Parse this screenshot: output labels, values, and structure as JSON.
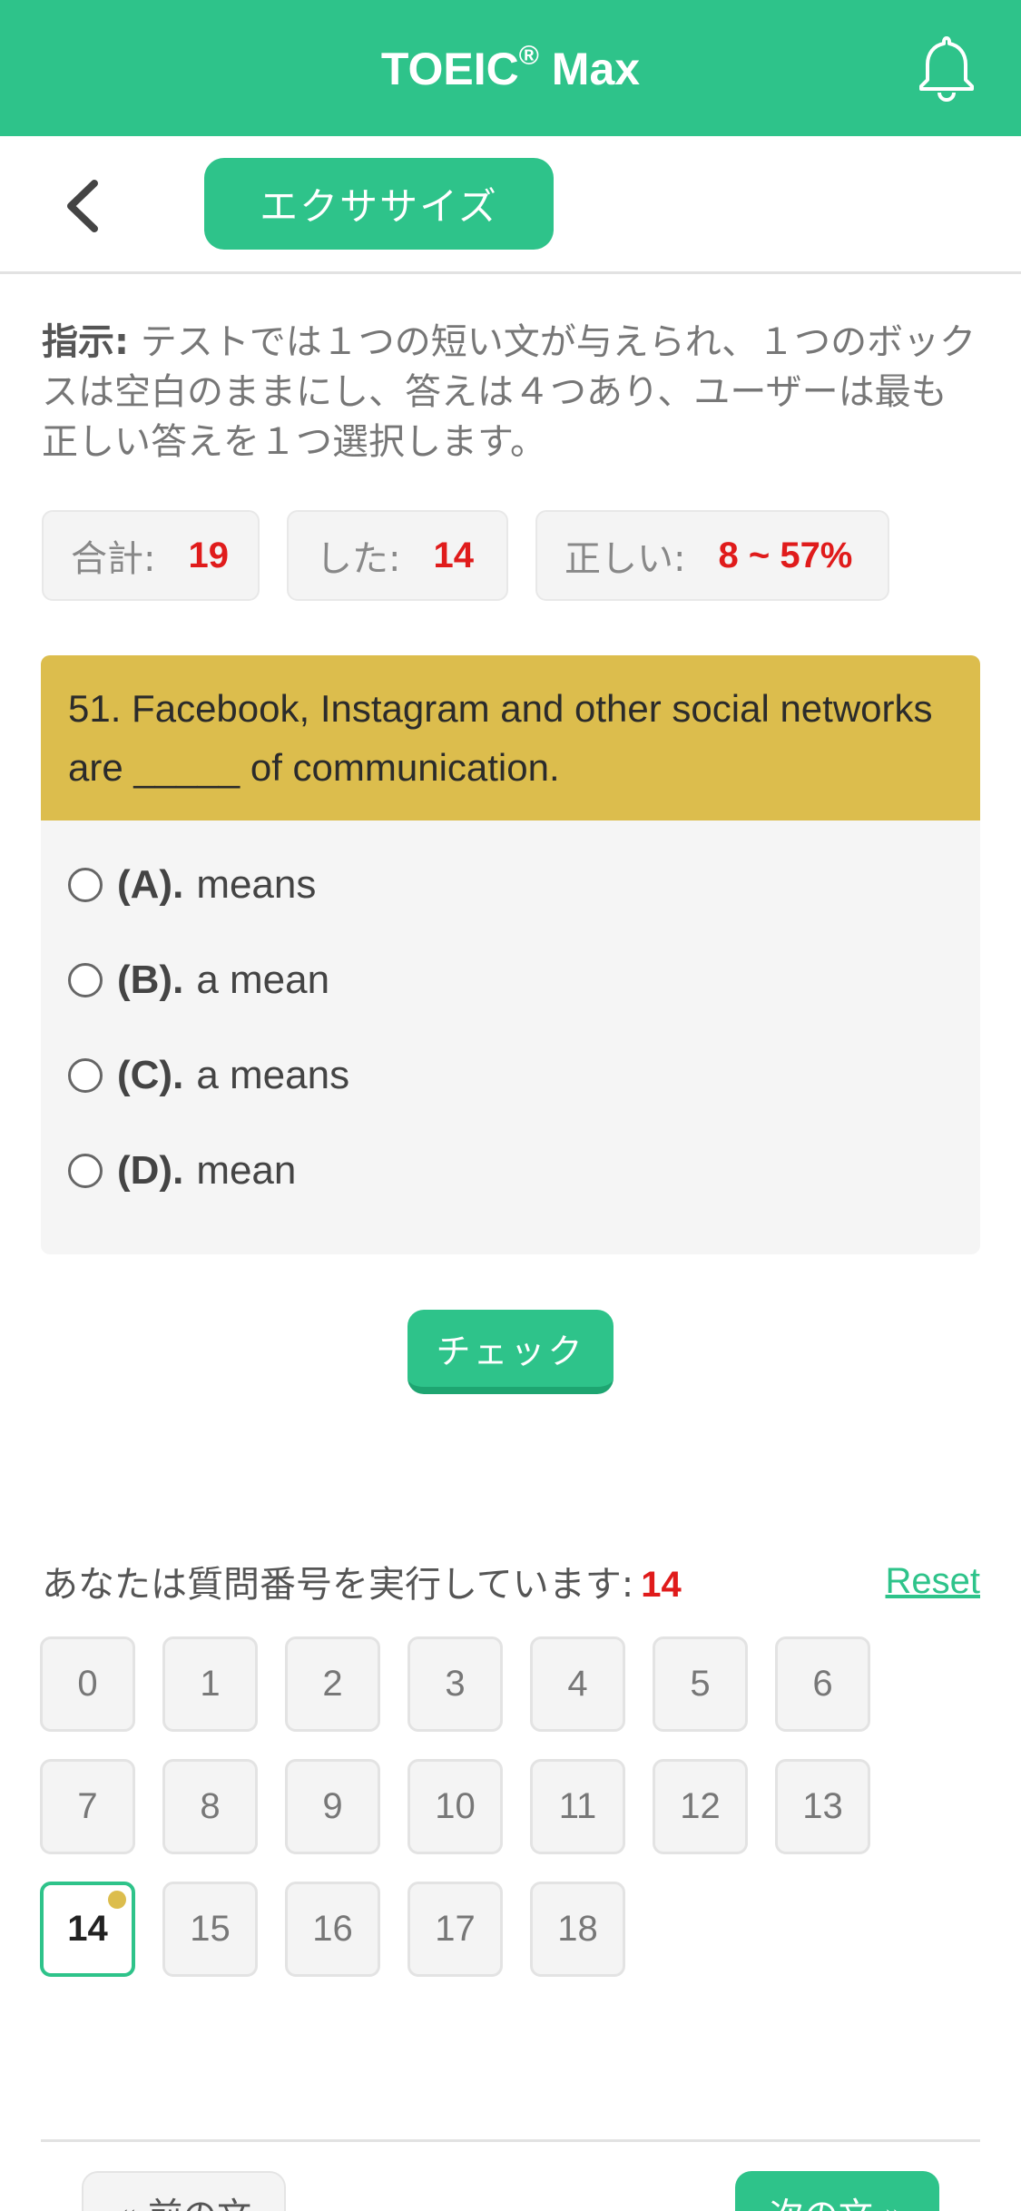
{
  "header": {
    "title": "TOEIC",
    "title_mark": "®",
    "title_suffix": " Max"
  },
  "subbar": {
    "tab_label": "エクササイズ"
  },
  "instructions": {
    "label": "指示:",
    "text": " テストでは１つの短い文が与えられ、１つのボックスは空白のままにし、答えは４つあり、ユーザーは最も正しい答えを１つ選択します。"
  },
  "stats": {
    "total_label": "合計:",
    "total_value": "19",
    "done_label": "した:",
    "done_value": "14",
    "correct_label": "正しい:",
    "correct_value": "8 ~ 57%"
  },
  "question": {
    "text": "51. Facebook, Instagram and other social networks are _____ of communication.",
    "options": [
      {
        "letter": "(A).",
        "text": "means"
      },
      {
        "letter": "(B).",
        "text": "a mean"
      },
      {
        "letter": "(C).",
        "text": "a means"
      },
      {
        "letter": "(D).",
        "text": "mean"
      }
    ]
  },
  "check_label": "チェック",
  "progress": {
    "label": "あなたは質問番号を実行しています:",
    "current": "14",
    "reset_label": "Reset"
  },
  "question_numbers": [
    "0",
    "1",
    "2",
    "3",
    "4",
    "5",
    "6",
    "7",
    "8",
    "9",
    "10",
    "11",
    "12",
    "13",
    "14",
    "15",
    "16",
    "17",
    "18"
  ],
  "active_number": "14",
  "nav": {
    "prev_label": "« 前の文",
    "next_label": "次の文 »"
  },
  "colors": {
    "primary": "#2ec38a",
    "question_bg": "#dcbd4d",
    "accent_red": "#e01b1b"
  }
}
